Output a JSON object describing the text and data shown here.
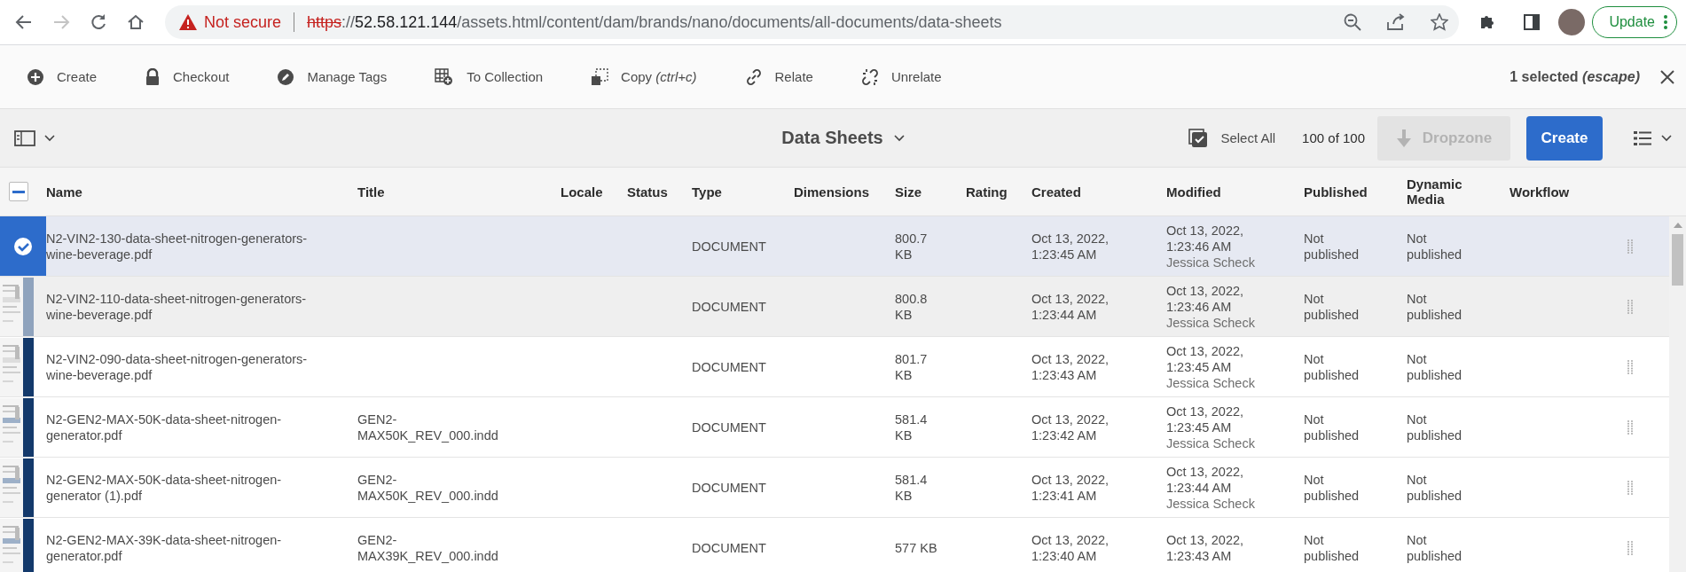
{
  "browser": {
    "back_disabled": false,
    "forward_disabled": true,
    "security": "Not secure",
    "url": {
      "scheme": "https",
      "separator": "://",
      "host": "52.58.121.144",
      "path": "/assets.html/content/dam/brands/nano/documents/all-documents/data-sheets"
    },
    "update_button": "Update"
  },
  "actions": [
    {
      "kind": "create",
      "label": "Create"
    },
    {
      "kind": "checkout",
      "label": "Checkout"
    },
    {
      "kind": "tags",
      "label": "Manage Tags"
    },
    {
      "kind": "collection",
      "label": "To Collection"
    },
    {
      "kind": "copy",
      "label": "Copy *(ctrl+c)*"
    },
    {
      "kind": "relate",
      "label": "Relate"
    },
    {
      "kind": "unrelate",
      "label": "Unrelate"
    }
  ],
  "selection": "1 selected *(escape)*",
  "titlebar": {
    "title": "Data Sheets",
    "select_all": "Select All",
    "count": "100 of 100",
    "dropzone": {
      "label": "Dropzone",
      "disabled": true
    },
    "create": "Create"
  },
  "table": {
    "header_checkbox": {
      "indeterminate": true
    },
    "columns": [
      "Name",
      "Title",
      "Locale",
      "Status",
      "Type",
      "Dimensions",
      "Size",
      "Rating",
      "Created",
      "Modified",
      "Published",
      "Dynamic Media",
      "Workflow"
    ],
    "rows": [
      {
        "selected": true,
        "highlighted": false,
        "name": "N2-VIN2-130-data-sheet-nitrogen-generators-wine-beverage.pdf",
        "type": "DOCUMENT",
        "size": "800.7 KB",
        "created": "Oct 13, 2022, 1:23:45 AM",
        "modified": "Oct 13, 2022, 1:23:46 AM",
        "modified_by": "Jessica Scheck",
        "published": "Not published",
        "dynamic_media": "Not published"
      },
      {
        "selected": false,
        "highlighted": true,
        "name": "N2-VIN2-110-data-sheet-nitrogen-generators-wine-beverage.pdf",
        "type": "DOCUMENT",
        "size": "800.8 KB",
        "created": "Oct 13, 2022, 1:23:44 AM",
        "modified": "Oct 13, 2022, 1:23:46 AM",
        "modified_by": "Jessica Scheck",
        "published": "Not published",
        "dynamic_media": "Not published"
      },
      {
        "selected": false,
        "highlighted": false,
        "name": "N2-VIN2-090-data-sheet-nitrogen-generators-wine-beverage.pdf",
        "type": "DOCUMENT",
        "size": "801.7 KB",
        "created": "Oct 13, 2022, 1:23:43 AM",
        "modified": "Oct 13, 2022, 1:23:45 AM",
        "modified_by": "Jessica Scheck",
        "published": "Not published",
        "dynamic_media": "Not published"
      },
      {
        "selected": false,
        "highlighted": false,
        "name": "N2-GEN2-MAX-50K-data-sheet-nitrogen-generator.pdf",
        "title": "GEN2-MAX50K_REV_000.indd",
        "type": "DOCUMENT",
        "size": "581.4 KB",
        "created": "Oct 13, 2022, 1:23:42 AM",
        "modified": "Oct 13, 2022, 1:23:45 AM",
        "modified_by": "Jessica Scheck",
        "published": "Not published",
        "dynamic_media": "Not published"
      },
      {
        "selected": false,
        "highlighted": false,
        "name": "N2-GEN2-MAX-50K-data-sheet-nitrogen-generator (1).pdf",
        "title": "GEN2-MAX50K_REV_000.indd",
        "type": "DOCUMENT",
        "size": "581.4 KB",
        "created": "Oct 13, 2022, 1:23:41 AM",
        "modified": "Oct 13, 2022, 1:23:44 AM",
        "modified_by": "Jessica Scheck",
        "published": "Not published",
        "dynamic_media": "Not published"
      },
      {
        "selected": false,
        "highlighted": false,
        "name": "N2-GEN2-MAX-39K-data-sheet-nitrogen-generator.pdf",
        "title": "GEN2-MAX39K_REV_000.indd",
        "type": "DOCUMENT",
        "size": "577 KB",
        "created": "Oct 13, 2022, 1:23:40 AM",
        "modified": "Oct 13, 2022, 1:23:43 AM",
        "published": "Not published",
        "dynamic_media": "Not published"
      }
    ]
  }
}
